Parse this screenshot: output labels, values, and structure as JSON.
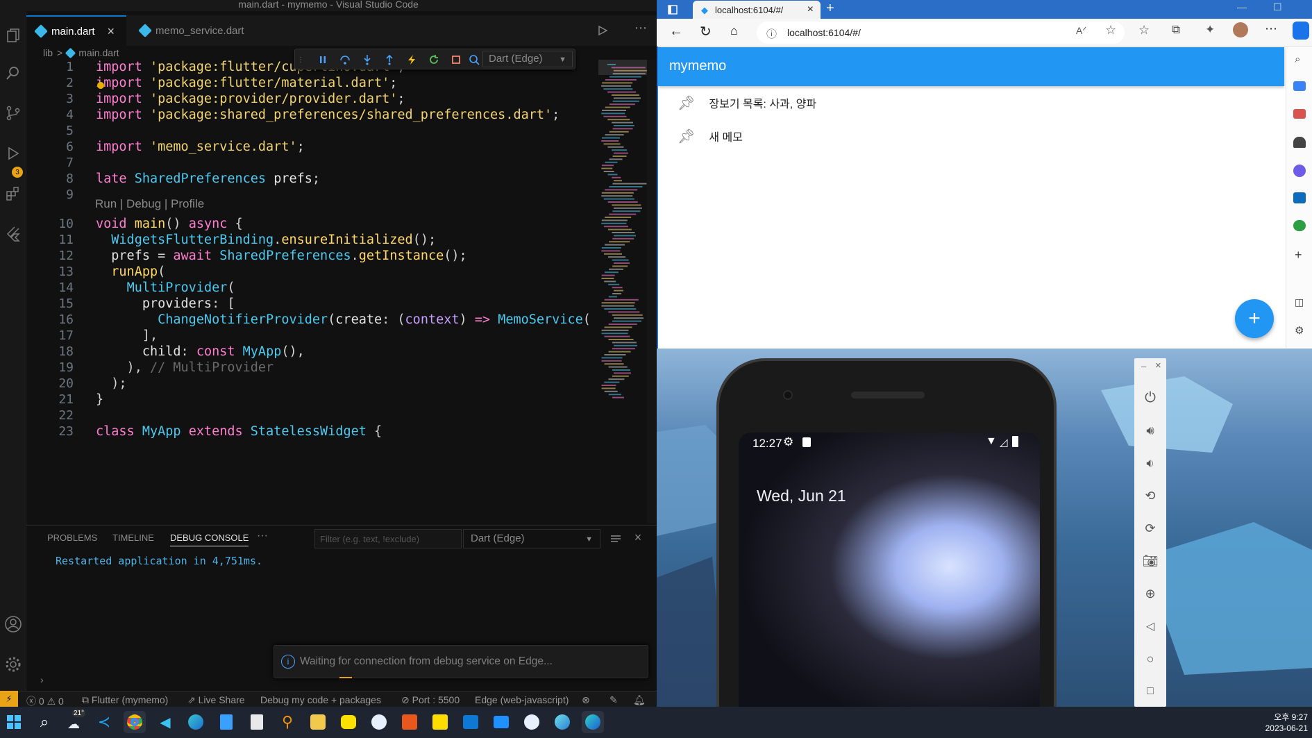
{
  "vscode": {
    "window_title": "main.dart - mymemo - Visual Studio Code",
    "tabs": [
      {
        "label": "main.dart",
        "close": "×"
      },
      {
        "label": "memo_service.dart"
      }
    ],
    "breadcrumb": [
      "lib",
      ">",
      "main.dart"
    ],
    "debug_config": "Dart (Edge)",
    "code_lens": "Run | Debug | Profile",
    "line_numbers": [
      "1",
      "2",
      "3",
      "4",
      "5",
      "6",
      "7",
      "8",
      "9",
      "10",
      "11",
      "12",
      "13",
      "14",
      "15",
      "16",
      "17",
      "18",
      "19",
      "20",
      "21",
      "22",
      "23"
    ],
    "panel": {
      "tabs": [
        "PROBLEMS",
        "TIMELINE",
        "DEBUG CONSOLE",
        "···"
      ],
      "filter_placeholder": "Filter (e.g. text, !exclude)",
      "config": "Dart (Edge)",
      "console_output": "Restarted application in 4,751ms."
    },
    "toast": "Waiting for connection from debug service on Edge...",
    "status": {
      "problems": "0",
      "warnings": "0",
      "flutter": "Flutter (mymemo)",
      "live_share": "Live Share",
      "debug_mode": "Debug my code + packages",
      "port": "Port : 5500",
      "target": "Edge (web-javascript)"
    },
    "activity_badge": "3",
    "accent_color": "#0a7acc"
  },
  "browser": {
    "tab_title": "localhost:6104/#/",
    "url": "localhost:6104/#/",
    "app": {
      "title": "mymemo",
      "memos": [
        "장보기 목록: 사과, 양파",
        "새 메모"
      ],
      "fab_label": "+",
      "primary_color": "#2196f3"
    }
  },
  "emulator": {
    "time": "12:27",
    "date": "Wed, Jun 21",
    "controls": [
      "power-icon",
      "volume-up-icon",
      "volume-down-icon",
      "rotate-left-icon",
      "rotate-right-icon",
      "camera-icon",
      "zoom-icon",
      "back-icon",
      "home-icon",
      "overview-icon"
    ]
  },
  "taskbar": {
    "weather_temp": "21°",
    "clock_time": "오후 9:27",
    "clock_date": "2023-06-21"
  }
}
